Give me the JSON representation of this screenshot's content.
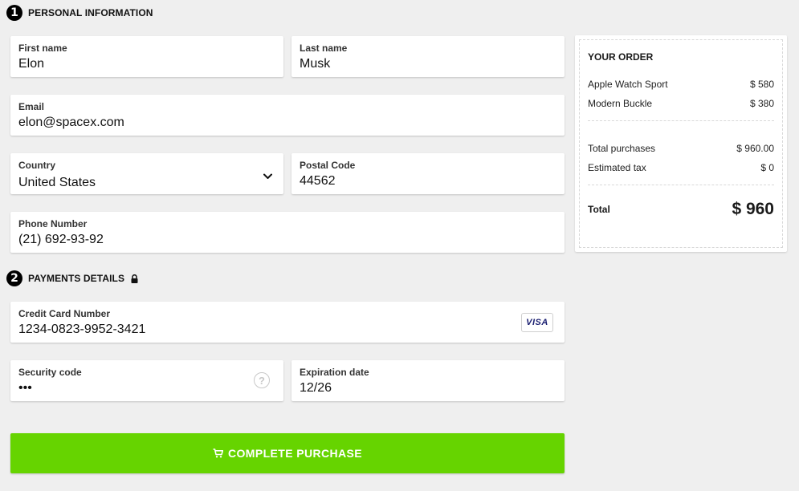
{
  "personal": {
    "step": "1",
    "title": "PERSONAL INFORMATION",
    "first_name": {
      "label": "First name",
      "value": "Elon"
    },
    "last_name": {
      "label": "Last name",
      "value": "Musk"
    },
    "email": {
      "label": "Email",
      "value": "elon@spacex.com"
    },
    "country": {
      "label": "Country",
      "value": "United States"
    },
    "postal_code": {
      "label": "Postal Code",
      "value": "44562"
    },
    "phone": {
      "label": "Phone Number",
      "value": "(21) 692-93-92"
    }
  },
  "payment": {
    "step": "2",
    "title": "PAYMENTS DETAILS",
    "card_number": {
      "label": "Credit Card Number",
      "value": "1234-0823-9952-3421",
      "brand": "VISA"
    },
    "security_code": {
      "label": "Security code",
      "value": "•••",
      "help": "?"
    },
    "expiration": {
      "label": "Expiration date",
      "value": "12/26"
    }
  },
  "button": {
    "label": "COMPLETE PURCHASE",
    "color": "#66d400"
  },
  "order": {
    "title": "YOUR ORDER",
    "items": [
      {
        "name": "Apple Watch Sport",
        "price": "$ 580"
      },
      {
        "name": "Modern Buckle",
        "price": "$ 380"
      }
    ],
    "total_purchases_label": "Total purchases",
    "total_purchases_value": "$ 960.00",
    "tax_label": "Estimated tax",
    "tax_value": "$ 0",
    "total_label": "Total",
    "total_value": "$ 960"
  },
  "icons": [
    "lock-icon",
    "chevron-down-icon",
    "visa-icon",
    "question-icon",
    "cart-icon"
  ]
}
